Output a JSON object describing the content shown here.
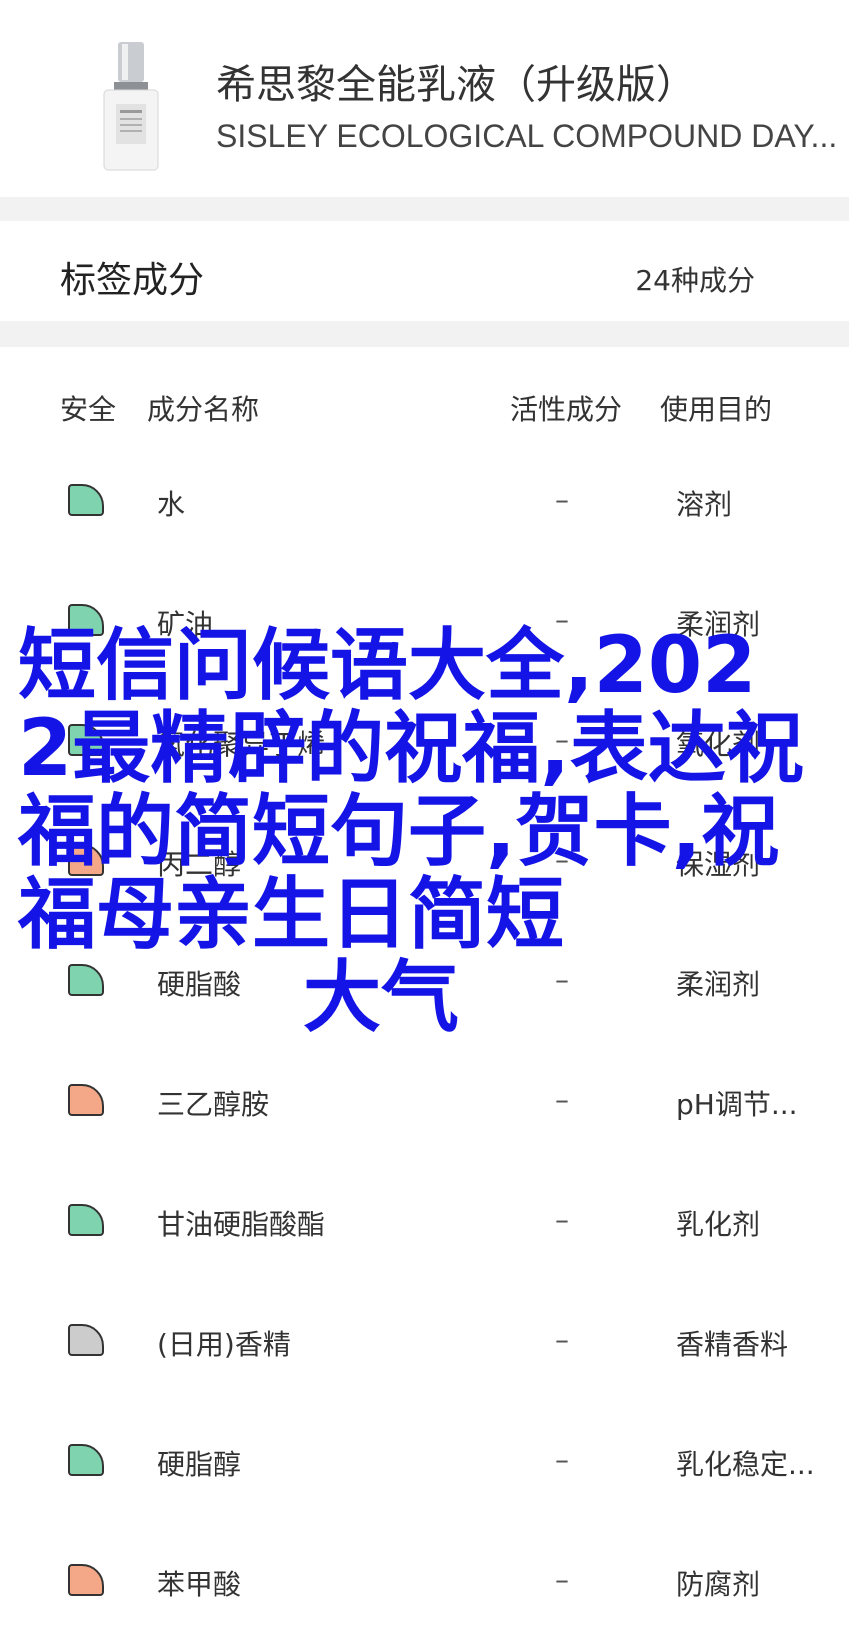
{
  "product": {
    "name": "希思黎全能乳液（升级版）",
    "name_en": "SISLEY ECOLOGICAL COMPOUND DAY...",
    "image_icon": "product-bottle-image"
  },
  "summary": {
    "title": "标签成分",
    "count": "24种成分"
  },
  "table": {
    "headers": {
      "safety": "安全",
      "name": "成分名称",
      "active": "活性成分",
      "use": "使用目的"
    },
    "rows": [
      {
        "name": "水",
        "active": "–",
        "use": "溶剂",
        "safety_color": "#7fd3ae"
      },
      {
        "name": "矿油",
        "active": "–",
        "use": "柔润剂",
        "safety_color": "#7fd3ae"
      },
      {
        "name": "氢化聚异丁烯",
        "active": "–",
        "use": "氧化剂",
        "safety_color": "#7fd3ae"
      },
      {
        "name": "丙二醇",
        "active": "–",
        "use": "保湿剂",
        "safety_color": "#f5a887"
      },
      {
        "name": "硬脂酸",
        "active": "–",
        "use": "柔润剂",
        "safety_color": "#7fd3ae"
      },
      {
        "name": "三乙醇胺",
        "active": "–",
        "use": "pH调节...",
        "safety_color": "#f5a887"
      },
      {
        "name": "甘油硬脂酸酯",
        "active": "–",
        "use": "乳化剂",
        "safety_color": "#7fd3ae"
      },
      {
        "name": "(日用)香精",
        "active": "–",
        "use": "香精香料",
        "safety_color": "#cccccc"
      },
      {
        "name": "硬脂醇",
        "active": "–",
        "use": "乳化稳定...",
        "safety_color": "#7fd3ae"
      },
      {
        "name": "苯甲酸",
        "active": "–",
        "use": "防腐剂",
        "safety_color": "#f5a887"
      }
    ]
  },
  "overlay": {
    "text_main": "短信问候语大全,2022最精辟的祝福,表达祝福的简短句子,贺卡,祝福母亲生日简短",
    "text_last": "大气",
    "color": "#1414e6"
  }
}
